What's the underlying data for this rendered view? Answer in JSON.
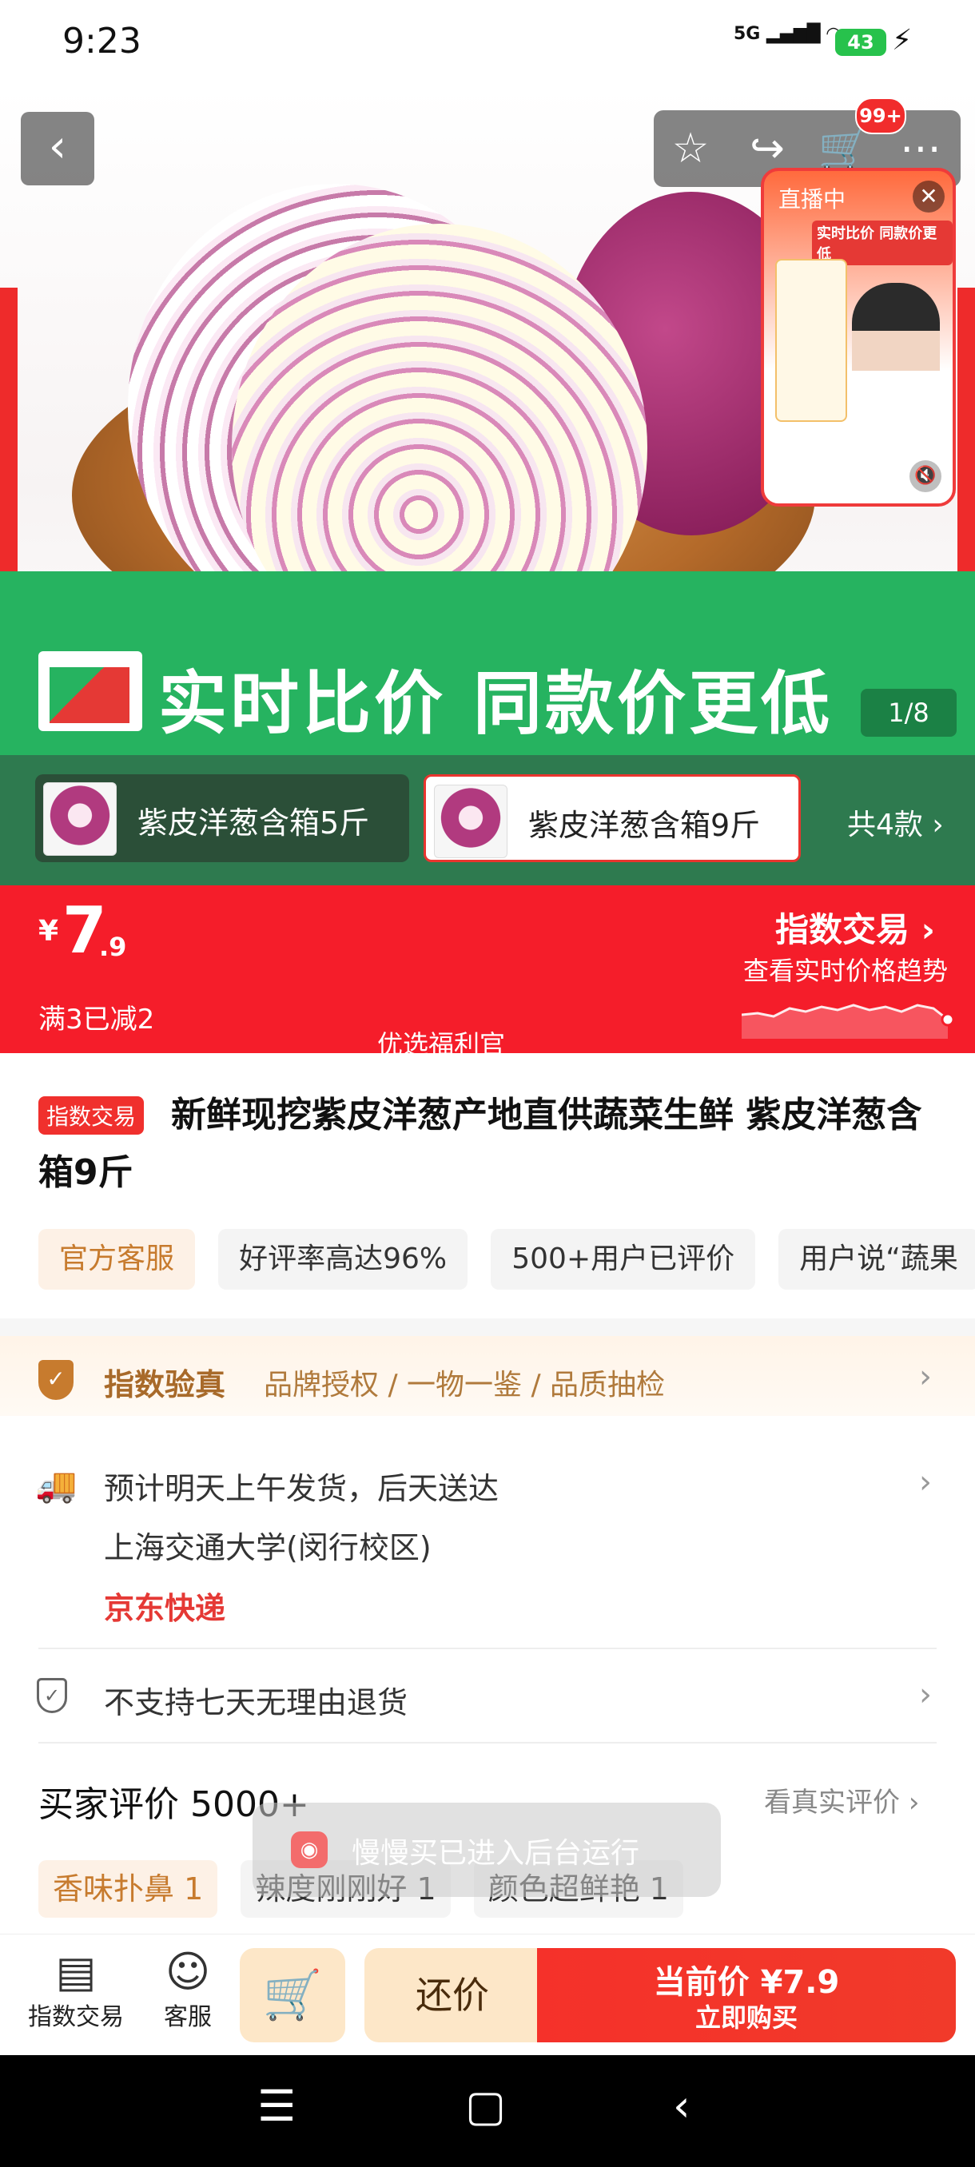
{
  "status": {
    "time": "9:23",
    "network": "5G",
    "battery": "43"
  },
  "nav": {
    "back_icon": "back-arrow-icon",
    "cart_badge": "99+"
  },
  "hero": {
    "promo_text": "实时比价 同款价更低",
    "counter": "1/8"
  },
  "live": {
    "label": "直播中",
    "subtitle": "实时比价 同款价更低"
  },
  "variants": {
    "items": [
      {
        "label": "紫皮洋葱含箱5斤",
        "selected": false
      },
      {
        "label": "紫皮洋葱含箱9斤",
        "selected": true
      }
    ],
    "more": "共4款"
  },
  "price": {
    "currency": "¥",
    "integer": "7",
    "decimal": ".9",
    "coupon": "满3已减2",
    "welfare": "优选福利官",
    "index_title": "指数交易",
    "index_sub": "查看实时价格趋势"
  },
  "product": {
    "tag": "指数交易",
    "title": "新鲜现挖紫皮洋葱产地直供蔬菜生鲜 紫皮洋葱含箱9斤",
    "chips": [
      "官方客服",
      "好评率高达96%",
      "500+用户已评价",
      "用户说“蔬果"
    ]
  },
  "verify": {
    "title": "指数验真",
    "desc": "品牌授权 / 一物一鉴 / 品质抽检"
  },
  "shipping": {
    "line1": "预计明天上午发货，后天送达",
    "line2": "上海交通大学(闵行校区)",
    "carrier": "京东快递"
  },
  "returns": {
    "text": "不支持七天无理由退货"
  },
  "reviews": {
    "title": "买家评价 5000+",
    "link": "看真实评价",
    "chips": [
      "香味扑鼻 1",
      "辣度刚刚好 1",
      "颜色超鲜艳 1"
    ]
  },
  "toast": {
    "text": "慢慢买已进入后台运行"
  },
  "bottom": {
    "index_label": "指数交易",
    "service_label": "客服",
    "bargain": "还价",
    "buy_top": "当前价 ¥7.9",
    "buy_bottom": "立即购买"
  },
  "colors": {
    "accent": "#f51d2a",
    "green": "#26b360",
    "gold": "#c77b2e"
  }
}
